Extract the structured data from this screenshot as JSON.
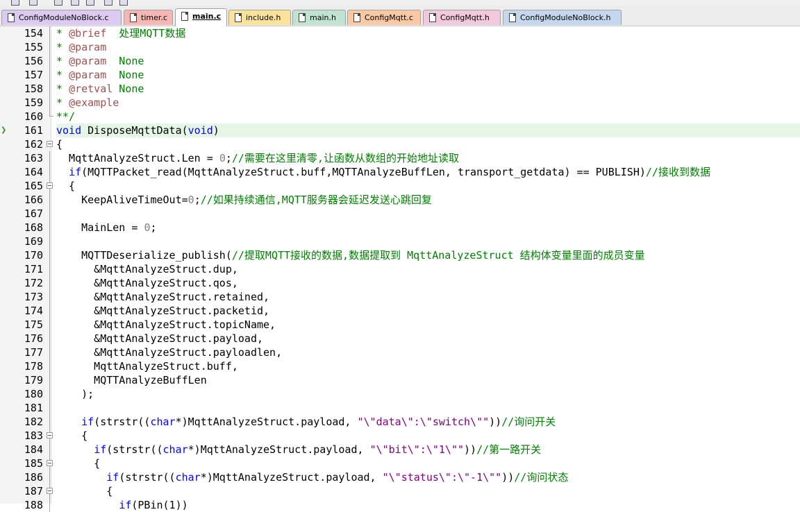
{
  "colors": {
    "comment": "#008000",
    "keyword": "#0000ff",
    "doc_tag": "#a05050",
    "string": "#800080",
    "number": "#808080",
    "current_line": "#e6f6e6"
  },
  "tabs": [
    {
      "label": "ConfigModuleNoBlock.c",
      "color": "#dccaf2",
      "active": false
    },
    {
      "label": "timer.c",
      "color": "#f7b6b2",
      "active": false
    },
    {
      "label": "main.c",
      "color": "#ffffff",
      "active": true
    },
    {
      "label": "include.h",
      "color": "#fde39a",
      "active": false
    },
    {
      "label": "main.h",
      "color": "#bfe3d0",
      "active": false
    },
    {
      "label": "ConfigMqtt.c",
      "color": "#fbc8a4",
      "active": false
    },
    {
      "label": "ConfigMqtt.h",
      "color": "#f2c8dc",
      "active": false
    },
    {
      "label": "ConfigModuleNoBlock.h",
      "color": "#c4d7ec",
      "active": false
    }
  ],
  "lines": [
    {
      "n": "154",
      "parts": [
        {
          "t": "* ",
          "c": "com"
        },
        {
          "t": "@brief",
          "c": "tag"
        },
        {
          "t": "  处理MQTT数据",
          "c": "com"
        }
      ]
    },
    {
      "n": "155",
      "parts": [
        {
          "t": "* ",
          "c": "com"
        },
        {
          "t": "@param",
          "c": "tag"
        }
      ]
    },
    {
      "n": "156",
      "parts": [
        {
          "t": "* ",
          "c": "com"
        },
        {
          "t": "@param",
          "c": "tag"
        },
        {
          "t": "  None",
          "c": "com"
        }
      ]
    },
    {
      "n": "157",
      "parts": [
        {
          "t": "* ",
          "c": "com"
        },
        {
          "t": "@param",
          "c": "tag"
        },
        {
          "t": "  None",
          "c": "com"
        }
      ]
    },
    {
      "n": "158",
      "parts": [
        {
          "t": "* ",
          "c": "com"
        },
        {
          "t": "@retval",
          "c": "tag"
        },
        {
          "t": " None",
          "c": "com"
        }
      ]
    },
    {
      "n": "159",
      "parts": [
        {
          "t": "* ",
          "c": "com"
        },
        {
          "t": "@example",
          "c": "tag"
        }
      ]
    },
    {
      "n": "160",
      "parts": [
        {
          "t": "**/",
          "c": "com"
        }
      ]
    },
    {
      "n": "161",
      "hl": true,
      "parts": [
        {
          "t": "void",
          "c": "kw"
        },
        {
          "t": " DisposeMqttData("
        },
        {
          "t": "void",
          "c": "kw"
        },
        {
          "t": ")"
        }
      ]
    },
    {
      "n": "162",
      "parts": [
        {
          "t": "{"
        }
      ]
    },
    {
      "n": "163",
      "parts": [
        {
          "t": "  MqttAnalyzeStruct.Len = "
        },
        {
          "t": "0",
          "c": "num"
        },
        {
          "t": ";"
        },
        {
          "t": "//需要在这里清零,让函数从数组的开始地址读取",
          "c": "com"
        }
      ]
    },
    {
      "n": "164",
      "parts": [
        {
          "t": "  "
        },
        {
          "t": "if",
          "c": "kw"
        },
        {
          "t": "(MQTTPacket_read(MqttAnalyzeStruct.buff,MQTTAnalyzeBuffLen, transport_getdata) == PUBLISH)"
        },
        {
          "t": "//接收到数据",
          "c": "com"
        }
      ]
    },
    {
      "n": "165",
      "parts": [
        {
          "t": "  {"
        }
      ]
    },
    {
      "n": "166",
      "parts": [
        {
          "t": "    KeepAliveTimeOut="
        },
        {
          "t": "0",
          "c": "num"
        },
        {
          "t": ";"
        },
        {
          "t": "//如果持续通信,MQTT服务器会延迟发送心跳回复",
          "c": "com"
        }
      ]
    },
    {
      "n": "167",
      "parts": []
    },
    {
      "n": "168",
      "parts": [
        {
          "t": "    MainLen = "
        },
        {
          "t": "0",
          "c": "num"
        },
        {
          "t": ";"
        }
      ]
    },
    {
      "n": "169",
      "parts": []
    },
    {
      "n": "170",
      "parts": [
        {
          "t": "    MQTTDeserialize_publish("
        },
        {
          "t": "//提取MQTT接收的数据,数据提取到 MqttAnalyzeStruct 结构体变量里面的成员变量",
          "c": "com"
        }
      ]
    },
    {
      "n": "171",
      "parts": [
        {
          "t": "      &MqttAnalyzeStruct.dup,"
        }
      ]
    },
    {
      "n": "172",
      "parts": [
        {
          "t": "      &MqttAnalyzeStruct.qos,"
        }
      ]
    },
    {
      "n": "173",
      "parts": [
        {
          "t": "      &MqttAnalyzeStruct.retained,"
        }
      ]
    },
    {
      "n": "174",
      "parts": [
        {
          "t": "      &MqttAnalyzeStruct.packetid,"
        }
      ]
    },
    {
      "n": "175",
      "parts": [
        {
          "t": "      &MqttAnalyzeStruct.topicName,"
        }
      ]
    },
    {
      "n": "176",
      "parts": [
        {
          "t": "      &MqttAnalyzeStruct.payload,"
        }
      ]
    },
    {
      "n": "177",
      "parts": [
        {
          "t": "      &MqttAnalyzeStruct.payloadlen,"
        }
      ]
    },
    {
      "n": "178",
      "parts": [
        {
          "t": "      MqttAnalyzeStruct.buff,"
        }
      ]
    },
    {
      "n": "179",
      "parts": [
        {
          "t": "      MQTTAnalyzeBuffLen"
        }
      ]
    },
    {
      "n": "180",
      "parts": [
        {
          "t": "    );"
        }
      ]
    },
    {
      "n": "181",
      "parts": []
    },
    {
      "n": "182",
      "parts": [
        {
          "t": "    "
        },
        {
          "t": "if",
          "c": "kw"
        },
        {
          "t": "(strstr(("
        },
        {
          "t": "char",
          "c": "kw"
        },
        {
          "t": "*)MqttAnalyzeStruct.payload, "
        },
        {
          "t": "\"\\\"data\\\":\\\"switch\\\"\"",
          "c": "str"
        },
        {
          "t": "))"
        },
        {
          "t": "//询问开关",
          "c": "com"
        }
      ]
    },
    {
      "n": "183",
      "parts": [
        {
          "t": "    {"
        }
      ]
    },
    {
      "n": "184",
      "parts": [
        {
          "t": "      "
        },
        {
          "t": "if",
          "c": "kw"
        },
        {
          "t": "(strstr(("
        },
        {
          "t": "char",
          "c": "kw"
        },
        {
          "t": "*)MqttAnalyzeStruct.payload, "
        },
        {
          "t": "\"\\\"bit\\\":\\\"1\\\"\"",
          "c": "str"
        },
        {
          "t": "))"
        },
        {
          "t": "//第一路开关",
          "c": "com"
        }
      ]
    },
    {
      "n": "185",
      "parts": [
        {
          "t": "      {"
        }
      ]
    },
    {
      "n": "186",
      "parts": [
        {
          "t": "        "
        },
        {
          "t": "if",
          "c": "kw"
        },
        {
          "t": "(strstr(("
        },
        {
          "t": "char",
          "c": "kw"
        },
        {
          "t": "*)MqttAnalyzeStruct.payload, "
        },
        {
          "t": "\"\\\"status\\\":\\\"-1\\\"\"",
          "c": "str"
        },
        {
          "t": "))"
        },
        {
          "t": "//询问状态",
          "c": "com"
        }
      ]
    },
    {
      "n": "187",
      "parts": [
        {
          "t": "        {"
        }
      ]
    },
    {
      "n": "188",
      "parts": [
        {
          "t": "          "
        },
        {
          "t": "if",
          "c": "kw"
        },
        {
          "t": "(PBin(1))"
        }
      ]
    }
  ]
}
